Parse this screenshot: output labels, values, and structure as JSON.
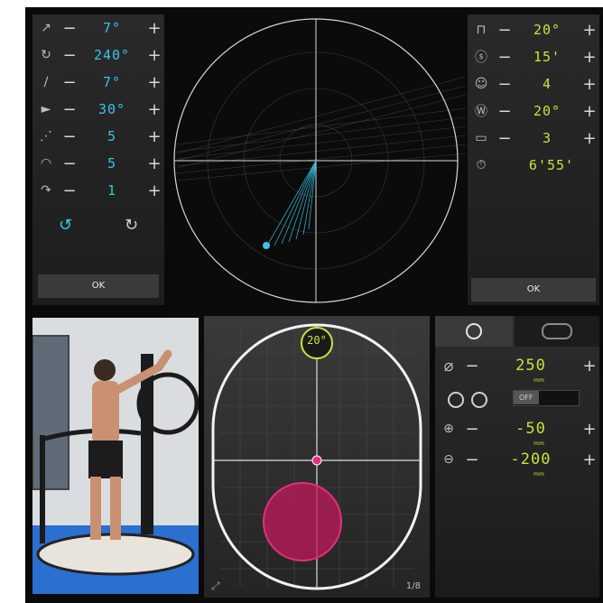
{
  "left_panel": {
    "rows": [
      {
        "icon": "angle-icon",
        "value": "7°"
      },
      {
        "icon": "rotation-icon",
        "value": "240°"
      },
      {
        "icon": "tilt-icon",
        "value": "7°"
      },
      {
        "icon": "cone-icon",
        "value": "30°"
      },
      {
        "icon": "sweep-icon",
        "value": "5"
      },
      {
        "icon": "speed-icon",
        "value": "5"
      },
      {
        "icon": "repeat-icon",
        "value": "1"
      }
    ],
    "ok_label": "OK"
  },
  "right_panel": {
    "rows": [
      {
        "icon": "height-icon",
        "value": "20°"
      },
      {
        "icon": "seconds-icon",
        "value": "15'"
      },
      {
        "icon": "head-icon",
        "value": "4"
      },
      {
        "icon": "weight-icon",
        "value": "20°"
      },
      {
        "icon": "battery-icon",
        "value": "3"
      },
      {
        "icon": "timer-icon",
        "value": "6'55'"
      }
    ],
    "ok_label": "OK"
  },
  "target_view": {
    "angle_label": "20°",
    "page_indicator": "1/8"
  },
  "settings_panel": {
    "diameter_value": "250",
    "toggle_label": "OFF",
    "x_offset_value": "-50",
    "y_offset_value": "-200",
    "unit": "mm"
  },
  "colors": {
    "accent_cyan": "#36c6e8",
    "accent_lime": "#c6e53a",
    "target_magenta": "#c2185b"
  }
}
